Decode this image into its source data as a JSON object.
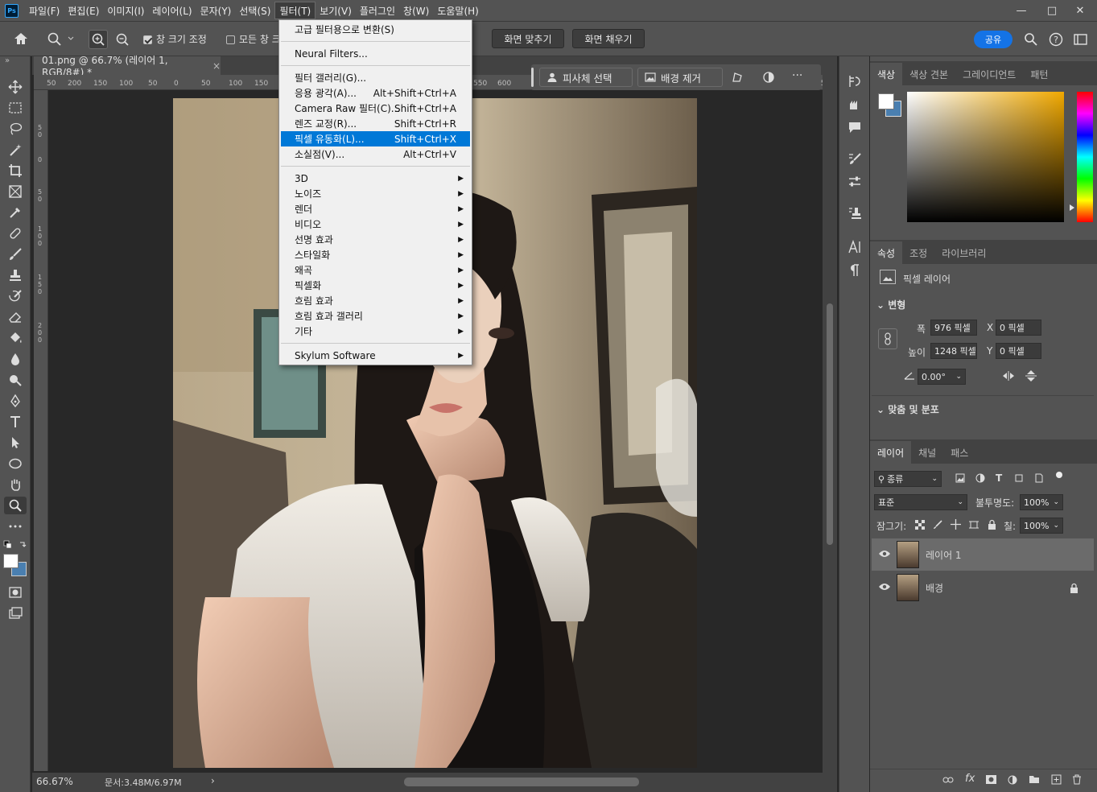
{
  "app": {
    "logo": "Ps"
  },
  "menubar": {
    "items": [
      "파일(F)",
      "편집(E)",
      "이미지(I)",
      "레이어(L)",
      "문자(Y)",
      "선택(S)",
      "필터(T)",
      "보기(V)",
      "플러그인",
      "창(W)",
      "도움말(H)"
    ],
    "active": "필터(T)"
  },
  "options": {
    "resize_windows": "창 크기 조정",
    "all_windows": "모든 창 크",
    "fit_screen": "화면 맞추기",
    "fill_screen": "화면 채우기",
    "share": "공유"
  },
  "document": {
    "tab_title": "01.png @ 66.7% (레이어 1, RGB/8#) *",
    "close": "×"
  },
  "contextbar": {
    "select_subject": "피사체 선택",
    "remove_bg": "배경 제거",
    "more": "···"
  },
  "ruler": {
    "h_ticks": [
      "50",
      "200",
      "150",
      "100",
      "50",
      "0",
      "50",
      "100",
      "150",
      "550",
      "600",
      "650"
    ],
    "v_ticks": [
      "5\n0",
      "0",
      "5\n0",
      "1\n0\n0",
      "1\n5\n0",
      "2\n0\n0"
    ]
  },
  "status": {
    "zoom": "66.67%",
    "doc_size": "문서:3.48M/6.97M",
    "arrow": "›"
  },
  "filter_menu": {
    "items": [
      {
        "label": "고급 필터용으로 변환(S)",
        "shortcut": "",
        "submenu": false
      },
      {
        "sep": true
      },
      {
        "label": "Neural Filters...",
        "shortcut": "",
        "submenu": false
      },
      {
        "sep": true
      },
      {
        "label": "필터 갤러리(G)...",
        "shortcut": "",
        "submenu": false
      },
      {
        "label": "응용 광각(A)...",
        "shortcut": "Alt+Shift+Ctrl+A",
        "submenu": false
      },
      {
        "label": "Camera Raw 필터(C)...",
        "shortcut": "Shift+Ctrl+A",
        "submenu": false
      },
      {
        "label": "렌즈 교정(R)...",
        "shortcut": "Shift+Ctrl+R",
        "submenu": false
      },
      {
        "label": "픽셀 유동화(L)...",
        "shortcut": "Shift+Ctrl+X",
        "submenu": false,
        "highlighted": true
      },
      {
        "label": "소실점(V)...",
        "shortcut": "Alt+Ctrl+V",
        "submenu": false
      },
      {
        "sep": true
      },
      {
        "label": "3D",
        "shortcut": "",
        "submenu": true
      },
      {
        "label": "노이즈",
        "shortcut": "",
        "submenu": true
      },
      {
        "label": "렌더",
        "shortcut": "",
        "submenu": true
      },
      {
        "label": "비디오",
        "shortcut": "",
        "submenu": true
      },
      {
        "label": "선명 효과",
        "shortcut": "",
        "submenu": true
      },
      {
        "label": "스타일화",
        "shortcut": "",
        "submenu": true
      },
      {
        "label": "왜곡",
        "shortcut": "",
        "submenu": true
      },
      {
        "label": "픽셀화",
        "shortcut": "",
        "submenu": true
      },
      {
        "label": "흐림 효과",
        "shortcut": "",
        "submenu": true
      },
      {
        "label": "흐림 효과 갤러리",
        "shortcut": "",
        "submenu": true
      },
      {
        "label": "기타",
        "shortcut": "",
        "submenu": true
      },
      {
        "sep": true
      },
      {
        "label": "Skylum Software",
        "shortcut": "",
        "submenu": true
      }
    ]
  },
  "color_panel": {
    "tabs": [
      "색상",
      "색상 견본",
      "그레이디언트",
      "패턴"
    ],
    "active": "색상",
    "hue_color": "#f0a800"
  },
  "properties_panel": {
    "tabs": [
      "속성",
      "조정",
      "라이브러리"
    ],
    "active": "속성",
    "layer_type": "픽셀 레이어",
    "transform_section": "변형",
    "width_label": "폭",
    "width_value": "976 픽셀",
    "height_label": "높이",
    "height_value": "1248 픽셀",
    "x_label": "X",
    "x_value": "0 픽셀",
    "y_label": "Y",
    "y_value": "0 픽셀",
    "angle_value": "0.00°",
    "align_section": "맞춤 및 분포"
  },
  "layers_panel": {
    "tabs": [
      "레이어",
      "채널",
      "패스"
    ],
    "active": "레이어",
    "filter_kind": "종류",
    "blend_mode": "표준",
    "opacity_label": "불투명도:",
    "opacity_value": "100%",
    "lock_label": "잠그기:",
    "fill_label": "칠:",
    "fill_value": "100%",
    "layers": [
      {
        "name": "레이어 1",
        "selected": true,
        "locked": false
      },
      {
        "name": "배경",
        "selected": false,
        "locked": true
      }
    ]
  },
  "colors": {
    "accent": "#1473e6",
    "menu_highlight": "#0078d7",
    "panel_bg": "#535353",
    "canvas_bg": "#282828"
  }
}
